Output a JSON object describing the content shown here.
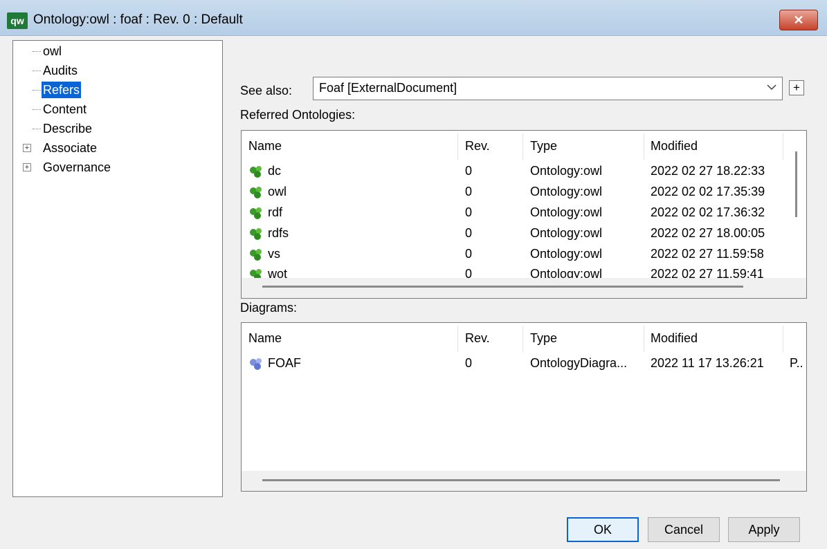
{
  "window": {
    "title": "Ontology:owl : foaf : Rev. 0  : Default",
    "icon_text": "qw",
    "close_glyph": "✕"
  },
  "tree": {
    "items": [
      {
        "label": "owl",
        "expandable": false,
        "selected": false
      },
      {
        "label": "Audits",
        "expandable": false,
        "selected": false
      },
      {
        "label": "Refers",
        "expandable": false,
        "selected": true
      },
      {
        "label": "Content",
        "expandable": false,
        "selected": false
      },
      {
        "label": "Describe",
        "expandable": false,
        "selected": false
      },
      {
        "label": "Associate",
        "expandable": true,
        "selected": false
      },
      {
        "label": "Governance",
        "expandable": true,
        "selected": false
      }
    ]
  },
  "see_also": {
    "label": "See also:",
    "value": "Foaf [ExternalDocument]",
    "add_glyph": "+"
  },
  "referred": {
    "label": "Referred Ontologies:",
    "columns": [
      "Name",
      "Rev.",
      "Type",
      "Modified"
    ],
    "rows": [
      {
        "name": "dc",
        "rev": "0",
        "type": "Ontology:owl",
        "modified": "2022 02 27 18.22:33"
      },
      {
        "name": "owl",
        "rev": "0",
        "type": "Ontology:owl",
        "modified": "2022 02 02 17.35:39"
      },
      {
        "name": "rdf",
        "rev": "0",
        "type": "Ontology:owl",
        "modified": "2022 02 02 17.36:32"
      },
      {
        "name": "rdfs",
        "rev": "0",
        "type": "Ontology:owl",
        "modified": "2022 02 27 18.00:05"
      },
      {
        "name": "vs",
        "rev": "0",
        "type": "Ontology:owl",
        "modified": "2022 02 27 11.59:58"
      },
      {
        "name": "wot",
        "rev": "0",
        "type": "Ontology:owl",
        "modified": "2022 02 27 11.59:41"
      }
    ],
    "icon_color": "#3a9a2a"
  },
  "diagrams": {
    "label": "Diagrams:",
    "columns": [
      "Name",
      "Rev.",
      "Type",
      "Modified"
    ],
    "rows": [
      {
        "name": "FOAF",
        "rev": "0",
        "type": "OntologyDiagra...",
        "modified": "2022 11 17 13.26:21",
        "extra": "P.."
      }
    ],
    "icon_color": "#7b8fe0"
  },
  "buttons": {
    "ok": "OK",
    "cancel": "Cancel",
    "apply": "Apply"
  }
}
